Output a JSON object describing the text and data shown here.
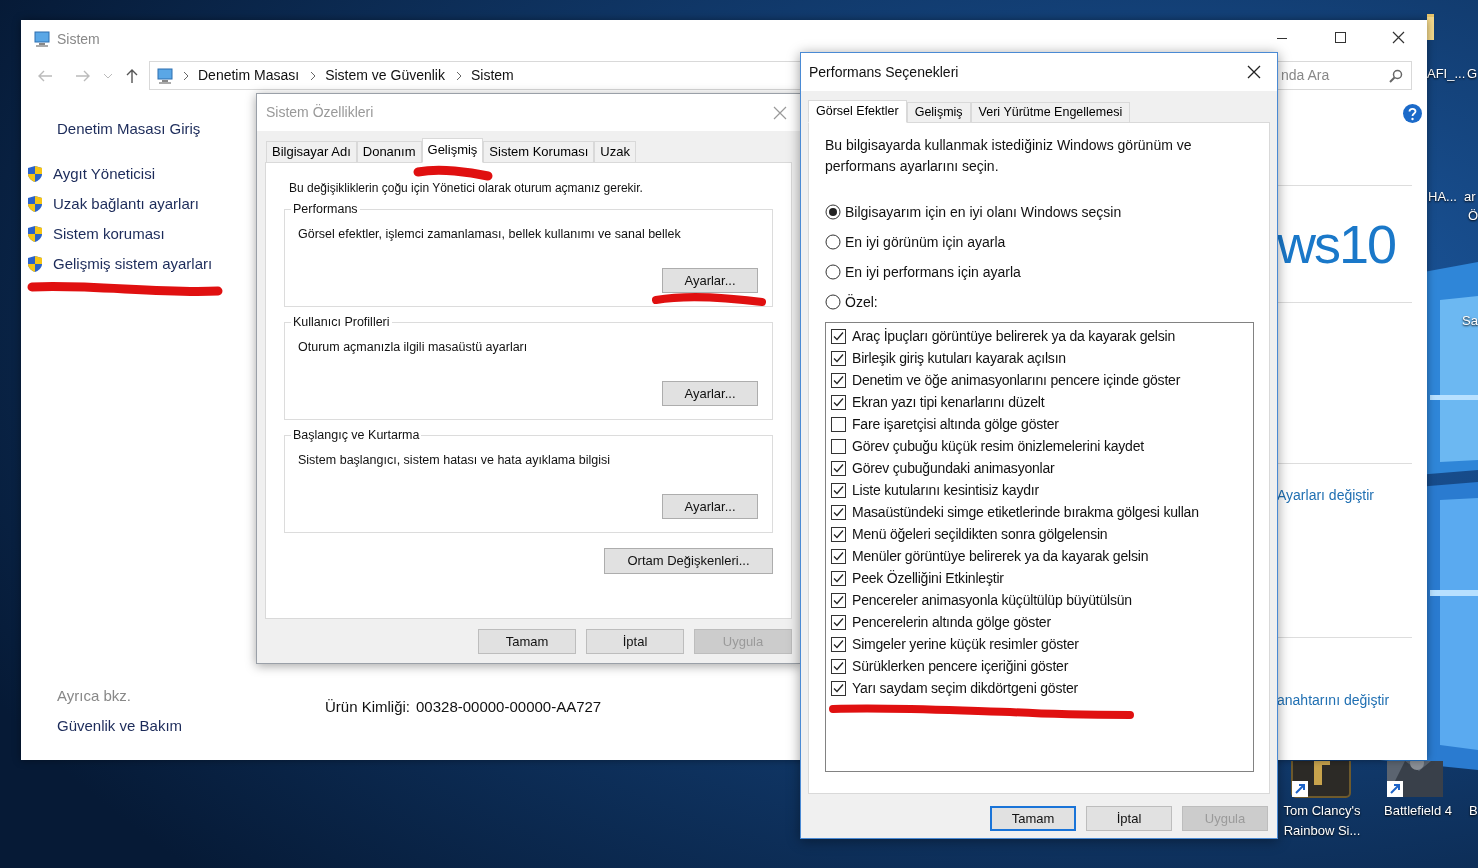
{
  "desktop": {
    "labels": [
      {
        "label": "AFI_..."
      },
      {
        "label": "G"
      },
      {
        "label": "HA..."
      },
      {
        "label": "ar"
      },
      {
        "label": "Ö"
      },
      {
        "label": "Sa"
      },
      {
        "label": "Tom Clancy's Rainbow Si..."
      },
      {
        "label": "Battlefield 4"
      },
      {
        "label": "B"
      }
    ]
  },
  "system_window": {
    "title": "Sistem",
    "breadcrumb": [
      "Denetim Masası",
      "Sistem ve Güvenlik",
      "Sistem"
    ],
    "search": {
      "placeholder": "nda Ara"
    },
    "sidebar": {
      "home": "Denetim Masası Giriş",
      "links": [
        "Aygıt Yöneticisi",
        "Uzak bağlantı ayarları",
        "Sistem koruması",
        "Gelişmiş sistem ayarları"
      ],
      "see_also_heading": "Ayrıca bkz.",
      "see_also_links": [
        "Güvenlik ve Bakım"
      ]
    },
    "logo_text": "ws10",
    "change_settings_link": "Ayarları değiştir",
    "product_key_link": "anahtarını değiştir",
    "product_id": {
      "label": "Ürün Kimliği:",
      "value": "00328-00000-00000-AA727"
    }
  },
  "system_properties": {
    "title": "Sistem Özellikleri",
    "tabs": [
      {
        "label": "Bilgisayar Adı",
        "selected": false
      },
      {
        "label": "Donanım",
        "selected": false
      },
      {
        "label": "Gelişmiş",
        "selected": true
      },
      {
        "label": "Sistem Koruması",
        "selected": false
      },
      {
        "label": "Uzak",
        "selected": false
      }
    ],
    "admin_note": "Bu değişikliklerin çoğu için Yönetici olarak oturum açmanız gerekir.",
    "groups": [
      {
        "title": "Performans",
        "description": "Görsel efektler, işlemci zamanlaması, bellek kullanımı ve sanal bellek",
        "button": "Ayarlar..."
      },
      {
        "title": "Kullanıcı Profilleri",
        "description": "Oturum açmanızla ilgili masaüstü ayarları",
        "button": "Ayarlar..."
      },
      {
        "title": "Başlangıç ve Kurtarma",
        "description": "Sistem başlangıcı, sistem hatası ve hata ayıklama bilgisi",
        "button": "Ayarlar..."
      }
    ],
    "environment_button": "Ortam Değişkenleri...",
    "buttons": [
      {
        "label": "Tamam",
        "disabled": false
      },
      {
        "label": "İptal",
        "disabled": false
      },
      {
        "label": "Uygula",
        "disabled": true
      }
    ]
  },
  "performance_options": {
    "title": "Performans Seçenekleri",
    "tabs": [
      {
        "label": "Görsel Efektler",
        "selected": true
      },
      {
        "label": "Gelişmiş",
        "selected": false
      },
      {
        "label": "Veri Yürütme Engellemesi",
        "selected": false
      }
    ],
    "intro": "Bu bilgisayarda kullanmak istediğiniz Windows görünüm ve performans ayarlarını seçin.",
    "modes": [
      {
        "label": "Bilgisayarım için en iyi olanı Windows seçsin",
        "selected": true
      },
      {
        "label": "En iyi görünüm için ayarla",
        "selected": false
      },
      {
        "label": "En iyi performans için ayarla",
        "selected": false
      },
      {
        "label": "Özel:",
        "selected": false
      }
    ],
    "effects": [
      {
        "label": "Araç İpuçları görüntüye belirerek ya da kayarak gelsin",
        "checked": true
      },
      {
        "label": "Birleşik giriş kutuları kayarak açılsın",
        "checked": true
      },
      {
        "label": "Denetim ve öğe animasyonlarını pencere içinde göster",
        "checked": true
      },
      {
        "label": "Ekran yazı tipi kenarlarını düzelt",
        "checked": true
      },
      {
        "label": "Fare işaretçisi altında gölge göster",
        "checked": false
      },
      {
        "label": "Görev çubuğu küçük resim önizlemelerini kaydet",
        "checked": false
      },
      {
        "label": "Görev çubuğundaki animasyonlar",
        "checked": true
      },
      {
        "label": "Liste kutularını kesintisiz kaydır",
        "checked": true
      },
      {
        "label": "Masaüstündeki simge etiketlerinde bırakma gölgesi kullan",
        "checked": true
      },
      {
        "label": "Menü öğeleri seçildikten sonra gölgelensin",
        "checked": true
      },
      {
        "label": "Menüler görüntüye belirerek ya da kayarak gelsin",
        "checked": true
      },
      {
        "label": "Peek Özelliğini Etkinleştir",
        "checked": true
      },
      {
        "label": "Pencereler animasyonla küçültülüp büyütülsün",
        "checked": true
      },
      {
        "label": "Pencerelerin altında gölge göster",
        "checked": true
      },
      {
        "label": "Simgeler yerine küçük resimler göster",
        "checked": true
      },
      {
        "label": "Sürüklerken pencere içeriğini göster",
        "checked": true
      },
      {
        "label": "Yarı saydam seçim dikdörtgeni göster",
        "checked": true
      }
    ],
    "buttons": [
      {
        "label": "Tamam",
        "default": true,
        "disabled": false
      },
      {
        "label": "İptal",
        "default": false,
        "disabled": false
      },
      {
        "label": "Uygula",
        "default": false,
        "disabled": true
      }
    ]
  }
}
